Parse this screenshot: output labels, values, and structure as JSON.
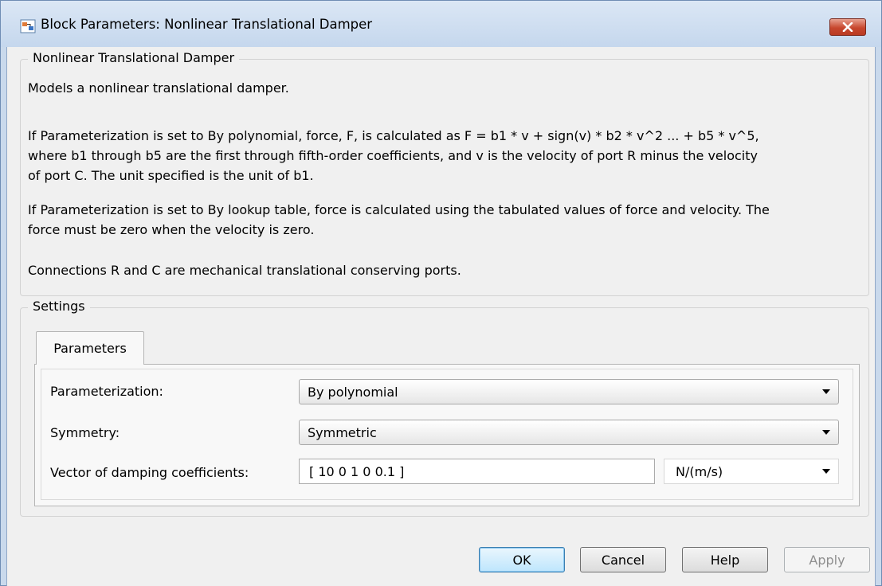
{
  "window": {
    "title": "Block Parameters: Nonlinear Translational Damper",
    "close_icon": "close-icon"
  },
  "description": {
    "group_label": "Nonlinear Translational Damper",
    "paragraphs": [
      "Models a nonlinear translational damper.",
      "If Parameterization is set to By polynomial, force, F, is calculated as F = b1 * v + sign(v) * b2 * v^2 ... + b5 * v^5,",
      "where b1 through b5 are the first through fifth-order coefficients, and v is the velocity of port R minus the velocity",
      "of port C. The unit specified is the unit of b1.",
      "If Parameterization is set to By lookup table, force is calculated using the tabulated values of force and velocity. The",
      "force must be zero when the velocity is zero.",
      "Connections R and C are mechanical translational conserving ports."
    ]
  },
  "settings": {
    "group_label": "Settings",
    "tab_label": "Parameters",
    "parameterization": {
      "label": "Parameterization:",
      "value": "By polynomial"
    },
    "symmetry": {
      "label": "Symmetry:",
      "value": "Symmetric"
    },
    "damping": {
      "label": "Vector of damping coefficients:",
      "value": "[ 10 0 1 0 0.1 ]",
      "unit": "N/(m/s)"
    }
  },
  "buttons": {
    "ok": "OK",
    "cancel": "Cancel",
    "help": "Help",
    "apply": "Apply"
  },
  "colors": {
    "frame": "#c9d9ec",
    "close_button": "#c7472e",
    "default_button": "#bee6fd"
  }
}
